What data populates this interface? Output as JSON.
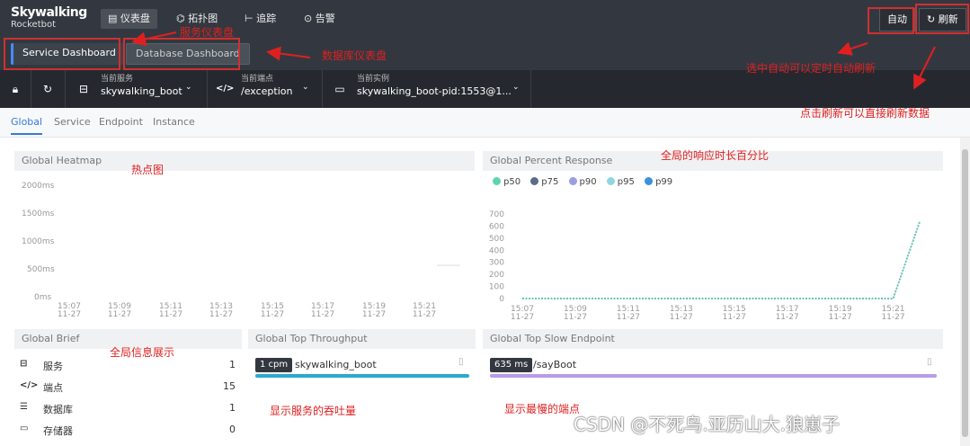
{
  "app": {
    "logo_line1": "Skywalking",
    "logo_line2": "Rocketbot"
  },
  "nav": [
    {
      "icon": "▤",
      "label": "仪表盘"
    },
    {
      "icon": "⌬",
      "label": "拓扑图"
    },
    {
      "icon": "⊢",
      "label": "追踪"
    },
    {
      "icon": "⊙",
      "label": "告警"
    }
  ],
  "top_buttons": {
    "auto": "自动",
    "refresh_icon": "↻",
    "refresh": "刷新"
  },
  "dashboards": {
    "service": "Service Dashboard",
    "database": "Database Dashboard"
  },
  "selectors": {
    "service_label": "当前服务",
    "service_value": "skywalking_boot",
    "endpoint_label": "当前端点",
    "endpoint_value": "/exception",
    "instance_label": "当前实例",
    "instance_value": "skywalking_boot-pid:1553@1..."
  },
  "sub_tabs": [
    "Global",
    "Service",
    "Endpoint",
    "Instance"
  ],
  "panels": {
    "heatmap_title": "Global Heatmap",
    "percent_title": "Global Percent Response",
    "brief_title": "Global Brief",
    "throughput_title": "Global Top Throughput",
    "slow_title": "Global Top Slow Endpoint"
  },
  "heatmap": {
    "y_labels": [
      "2000ms",
      "1500ms",
      "1000ms",
      "500ms",
      "0ms"
    ],
    "x_labels": [
      [
        "15:07",
        "11-27"
      ],
      [
        "15:09",
        "11-27"
      ],
      [
        "15:11",
        "11-27"
      ],
      [
        "15:13",
        "11-27"
      ],
      [
        "15:15",
        "11-27"
      ],
      [
        "15:17",
        "11-27"
      ],
      [
        "15:19",
        "11-27"
      ],
      [
        "15:21",
        "11-27"
      ]
    ]
  },
  "chart_data": {
    "type": "line",
    "x": [
      "15:07",
      "15:08",
      "15:09",
      "15:10",
      "15:11",
      "15:12",
      "15:13",
      "15:14",
      "15:15",
      "15:16",
      "15:17",
      "15:18",
      "15:19",
      "15:20",
      "15:21",
      "15:22"
    ],
    "x_tick_labels": [
      [
        "15:07",
        "11-27"
      ],
      [
        "15:09",
        "11-27"
      ],
      [
        "15:11",
        "11-27"
      ],
      [
        "15:13",
        "11-27"
      ],
      [
        "15:15",
        "11-27"
      ],
      [
        "15:17",
        "11-27"
      ],
      [
        "15:19",
        "11-27"
      ],
      [
        "15:21",
        "11-27"
      ]
    ],
    "y_ticks": [
      0,
      100,
      200,
      300,
      400,
      500,
      600,
      700
    ],
    "ylim": [
      0,
      700
    ],
    "series": [
      {
        "name": "p50",
        "color": "#5ed4b0",
        "values": [
          0,
          0,
          0,
          0,
          0,
          0,
          0,
          0,
          0,
          0,
          0,
          0,
          0,
          0,
          0,
          635
        ]
      },
      {
        "name": "p75",
        "color": "#5c6b8a",
        "values": [
          0,
          0,
          0,
          0,
          0,
          0,
          0,
          0,
          0,
          0,
          0,
          0,
          0,
          0,
          0,
          635
        ]
      },
      {
        "name": "p90",
        "color": "#9b9ee0",
        "values": [
          0,
          0,
          0,
          0,
          0,
          0,
          0,
          0,
          0,
          0,
          0,
          0,
          0,
          0,
          0,
          635
        ]
      },
      {
        "name": "p95",
        "color": "#8fd6df",
        "values": [
          0,
          0,
          0,
          0,
          0,
          0,
          0,
          0,
          0,
          0,
          0,
          0,
          0,
          0,
          0,
          635
        ]
      },
      {
        "name": "p99",
        "color": "#3b8fe0",
        "values": [
          0,
          0,
          0,
          0,
          0,
          0,
          0,
          0,
          0,
          0,
          0,
          0,
          0,
          0,
          0,
          635
        ]
      }
    ]
  },
  "brief": [
    {
      "icon": "⊟",
      "name": "服务",
      "count": "1"
    },
    {
      "icon": "</>",
      "name": "端点",
      "count": "15"
    },
    {
      "icon": "☰",
      "name": "数据库",
      "count": "1"
    },
    {
      "icon": "▭",
      "name": "存储器",
      "count": "0"
    }
  ],
  "throughput": {
    "badge": "1 cpm",
    "name": "skywalking_boot",
    "bar_color": "#2aa9cf"
  },
  "slow": {
    "badge": "635 ms",
    "name": "/sayBoot",
    "bar_color": "#b99ae8"
  },
  "annotations": {
    "service_dash": "服务仪表盘",
    "db_dash": "数据库仪表盘",
    "auto_tip": "选中自动可以定时自动刷新",
    "refresh_tip": "点击刷新可以直接刷新数据",
    "heatmap": "热点图",
    "percent": "全局的响应时长百分比",
    "brief": "全局信息展示",
    "throughput": "显示服务的吞吐量",
    "slow": "显示最慢的端点"
  },
  "watermark": "CSDN @不死鸟.亚历山大.狼崽子"
}
